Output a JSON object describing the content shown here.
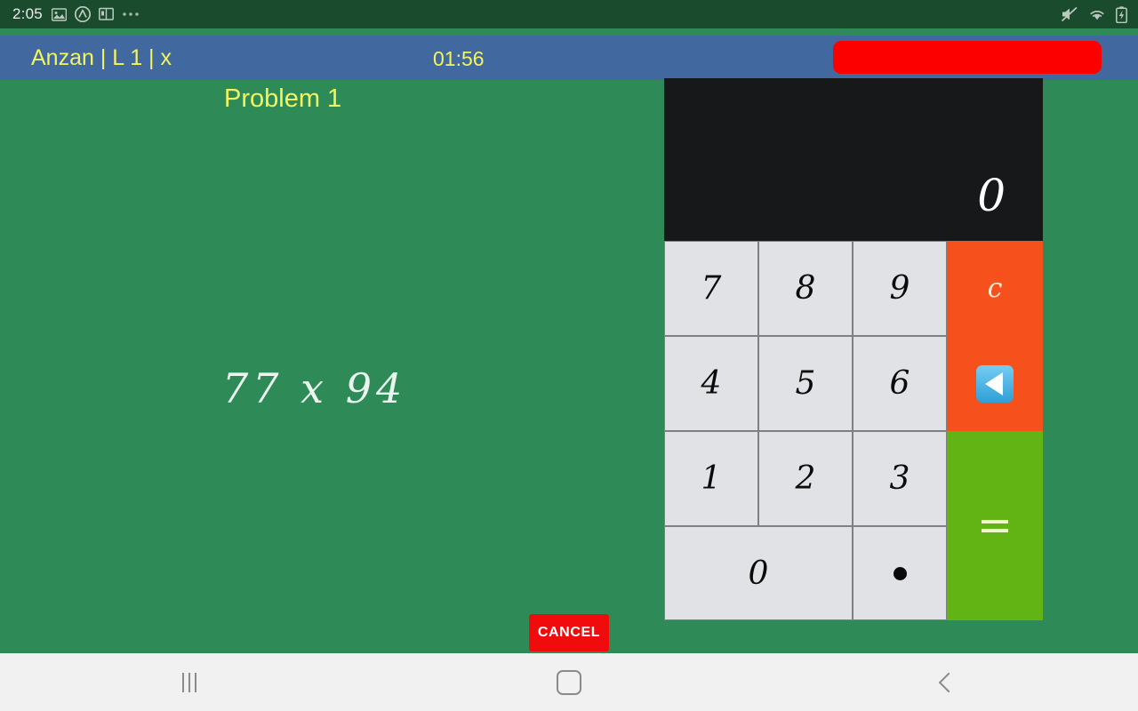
{
  "status_bar": {
    "clock": "2:05",
    "left_icons": [
      "image-icon",
      "app-circle-a-icon",
      "dictionary-icon",
      "more-ellipsis-icon"
    ],
    "right_icons": [
      "mute-icon",
      "wifi-icon",
      "battery-charging-icon"
    ],
    "background": "#1b4b2d"
  },
  "title_bar": {
    "app_title": "Anzan | L 1 | x",
    "timer": "01:56",
    "record_button_label": "",
    "background": "#41699f",
    "title_color": "#f2f55e",
    "record_color": "#fc0000"
  },
  "board": {
    "problem_label": "Problem 1",
    "problem_expression": "77 x 94",
    "cancel_label": "CANCEL",
    "background": "#2e8b57",
    "label_color": "#f2f55e",
    "expression_color": "#e9f5ee",
    "cancel_color": "#f00c0c"
  },
  "calculator": {
    "display_value": "0",
    "display_background": "#17181a",
    "key_background": "#e0e2e5",
    "function_clear_color": "#f6511d",
    "function_equals_color": "#62b314",
    "keys": [
      {
        "id": "key-7",
        "label": "7",
        "kind": "digit"
      },
      {
        "id": "key-8",
        "label": "8",
        "kind": "digit"
      },
      {
        "id": "key-9",
        "label": "9",
        "kind": "digit"
      },
      {
        "id": "key-clear",
        "label": "c",
        "kind": "clear"
      },
      {
        "id": "key-4",
        "label": "4",
        "kind": "digit"
      },
      {
        "id": "key-5",
        "label": "5",
        "kind": "digit"
      },
      {
        "id": "key-6",
        "label": "6",
        "kind": "digit"
      },
      {
        "id": "key-backspace",
        "label": "",
        "kind": "backspace"
      },
      {
        "id": "key-1",
        "label": "1",
        "kind": "digit"
      },
      {
        "id": "key-2",
        "label": "2",
        "kind": "digit"
      },
      {
        "id": "key-3",
        "label": "3",
        "kind": "digit"
      },
      {
        "id": "key-equals",
        "label": "=",
        "kind": "equals"
      },
      {
        "id": "key-0",
        "label": "0",
        "kind": "digit-wide"
      },
      {
        "id": "key-decimal",
        "label": ".",
        "kind": "decimal"
      }
    ]
  },
  "nav_bar": {
    "recents_label": "recents",
    "home_label": "home",
    "back_label": "back",
    "background": "#f1f1f1"
  }
}
